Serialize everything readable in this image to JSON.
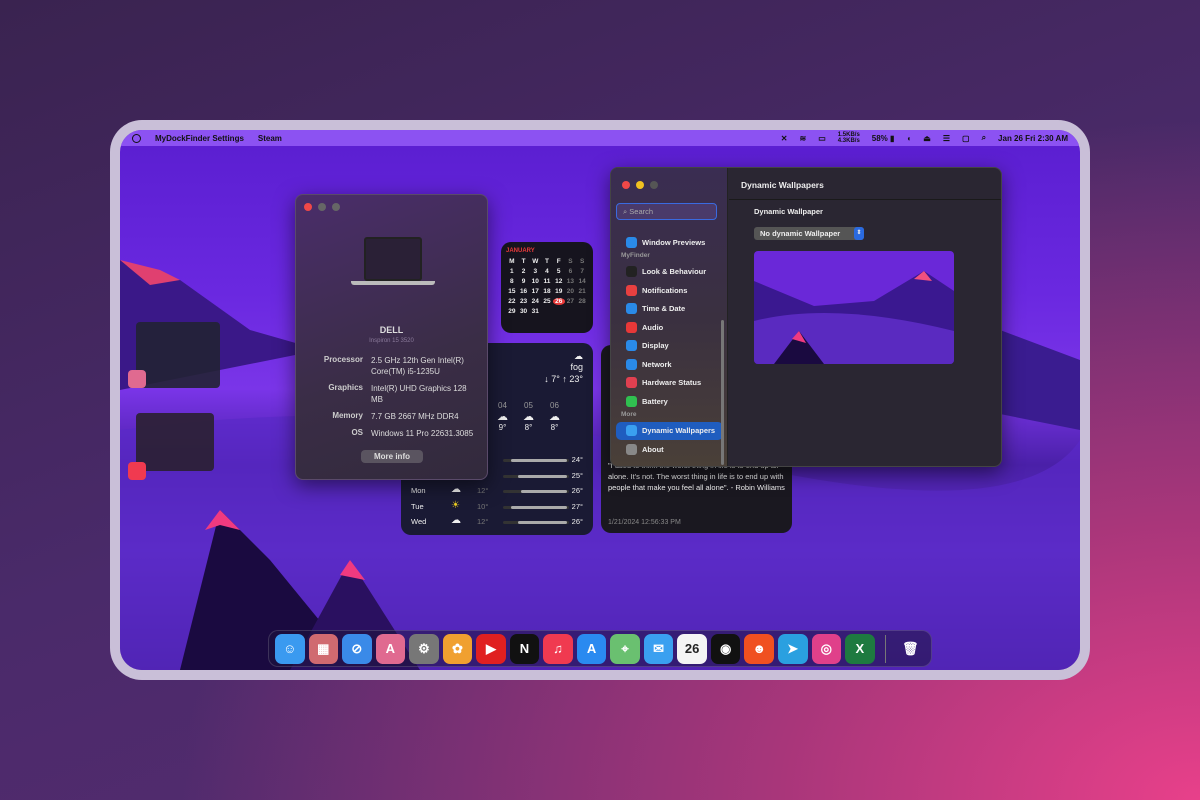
{
  "menubar": {
    "app": "MyDockFinder Settings",
    "menu": "Steam",
    "net_up": "1.5KB/s",
    "net_down": "4.3KB/s",
    "battery": "58%",
    "clock": "Jan 26 Fri 2:30 AM"
  },
  "about": {
    "brand": "DELL",
    "model": "Inspiron 15 3520",
    "specs": [
      {
        "k": "Processor",
        "v": "2.5 GHz 12th Gen Intel(R) Core(TM) i5-1235U"
      },
      {
        "k": "Graphics",
        "v": "Intel(R) UHD Graphics  128 MB"
      },
      {
        "k": "Memory",
        "v": "7.7 GB  2667 MHz DDR4"
      },
      {
        "k": "OS",
        "v": "Windows 11 Pro 22631.3085"
      }
    ],
    "button": "More info"
  },
  "calendar": {
    "month": "JANUARY",
    "weekdays": [
      "M",
      "T",
      "W",
      "T",
      "F",
      "S",
      "S"
    ],
    "days": [
      "1",
      "2",
      "3",
      "4",
      "5",
      "6",
      "7",
      "8",
      "9",
      "10",
      "11",
      "12",
      "13",
      "14",
      "15",
      "16",
      "17",
      "18",
      "19",
      "20",
      "21",
      "22",
      "23",
      "24",
      "25",
      "26",
      "27",
      "28",
      "29",
      "30",
      "31"
    ],
    "today": "26"
  },
  "weather": {
    "condition": "fog",
    "low": "↓ 7°",
    "high": "↑ 23°",
    "hourly": [
      {
        "h": "04",
        "t": "9°"
      },
      {
        "h": "05",
        "t": "8°"
      },
      {
        "h": "06",
        "t": "8°"
      }
    ],
    "daily": [
      {
        "d": "",
        "lo": "",
        "hi": "24°",
        "icon": "",
        "fill": 0.85
      },
      {
        "d": "",
        "lo": "",
        "hi": "25°",
        "icon": "",
        "fill": 0.75
      },
      {
        "d": "Mon",
        "lo": "12°",
        "hi": "26°",
        "icon": "cloud",
        "fill": 0.7
      },
      {
        "d": "Tue",
        "lo": "10°",
        "hi": "27°",
        "icon": "sun",
        "fill": 0.85
      },
      {
        "d": "Wed",
        "lo": "12°",
        "hi": "26°",
        "icon": "cloud",
        "fill": 0.75
      }
    ]
  },
  "quote": {
    "text": "\"I used to think the worst thing in life is to end up all alone. It's not. The worst thing in life is to end up with people that make you feel all alone\". - Robin Williams",
    "timestamp": "1/21/2024 12:56:33 PM"
  },
  "settings": {
    "title": "Dynamic Wallpapers",
    "search_placeholder": "Search",
    "section_label": "Dynamic Wallpaper",
    "select_value": "No dynamic Wallpaper",
    "sidebar": [
      {
        "label": "Window Previews",
        "color": "#2a8ae8"
      },
      {
        "section": "MyFinder"
      },
      {
        "label": "Look & Behaviour",
        "color": "#222"
      },
      {
        "label": "Notifications",
        "color": "#e84040"
      },
      {
        "label": "Time & Date",
        "color": "#2a8ae8"
      },
      {
        "label": "Audio",
        "color": "#e83838"
      },
      {
        "label": "Display",
        "color": "#2a8ae8"
      },
      {
        "label": "Network",
        "color": "#2a8ae8"
      },
      {
        "label": "Hardware Status",
        "color": "#e04050"
      },
      {
        "label": "Battery",
        "color": "#30c050"
      },
      {
        "section": "More"
      },
      {
        "label": "Dynamic Wallpapers",
        "color": "#3aa0f0",
        "active": true
      },
      {
        "label": "About",
        "color": "#888"
      }
    ]
  },
  "dock": [
    {
      "name": "finder",
      "g": "☺",
      "c": "#3a9af0"
    },
    {
      "name": "launchpad",
      "g": "▦",
      "c": "#d06a70"
    },
    {
      "name": "safari",
      "g": "⊘",
      "c": "#3a8ae8"
    },
    {
      "name": "app-a",
      "g": "A",
      "c": "#e06a90"
    },
    {
      "name": "settings",
      "g": "⚙",
      "c": "#777"
    },
    {
      "name": "photos",
      "g": "✿",
      "c": "#f0a030"
    },
    {
      "name": "youtube",
      "g": "▶",
      "c": "#e02020"
    },
    {
      "name": "netflix",
      "g": "N",
      "c": "#111"
    },
    {
      "name": "music",
      "g": "♫",
      "c": "#f03a50"
    },
    {
      "name": "app-store",
      "g": "A",
      "c": "#2a8af0"
    },
    {
      "name": "maps",
      "g": "⌖",
      "c": "#6ac070"
    },
    {
      "name": "mail",
      "g": "✉",
      "c": "#3aa0f0"
    },
    {
      "name": "calendar",
      "g": "26",
      "c": "#f4f4f4"
    },
    {
      "name": "github",
      "g": "◉",
      "c": "#111"
    },
    {
      "name": "reddit",
      "g": "☻",
      "c": "#f05020"
    },
    {
      "name": "telegram",
      "g": "➤",
      "c": "#2aa0e0"
    },
    {
      "name": "instagram",
      "g": "◎",
      "c": "#e0408a"
    },
    {
      "name": "excel",
      "g": "X",
      "c": "#1e7a40"
    },
    {
      "name": "trash",
      "g": "🗑",
      "c": "transparent"
    }
  ]
}
